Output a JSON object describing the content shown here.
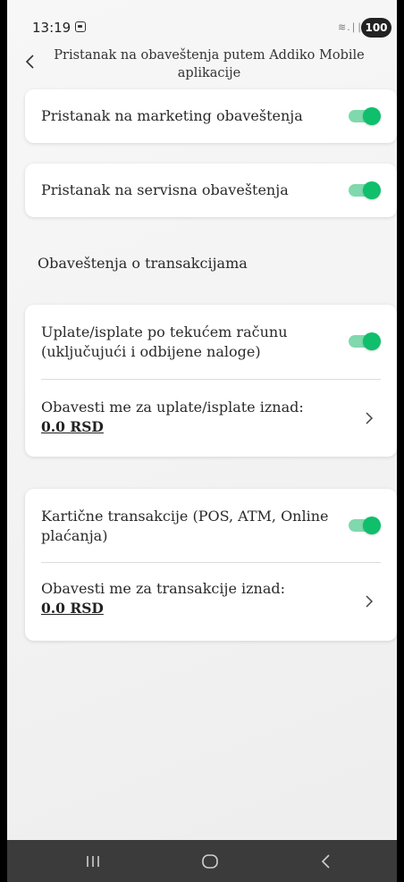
{
  "status_bar": {
    "time": "13:19",
    "signal": "≋.∣∣",
    "battery": "100"
  },
  "header": {
    "title": "Pristanak na obaveštenja putem Addiko Mobile aplikacije"
  },
  "settings": {
    "marketing": {
      "label": "Pristanak na marketing obaveštenja",
      "enabled": true
    },
    "service": {
      "label": "Pristanak na servisna obaveštenja",
      "enabled": true
    }
  },
  "transactions": {
    "section_label": "Obaveštenja o transakcijama",
    "account": {
      "label": "Uplate/isplate po tekućem računu (uključujući i odbijene naloge)",
      "enabled": true,
      "threshold_label": "Obavesti me za uplate/isplate iznad:",
      "threshold_amount": "0.0 RSD"
    },
    "card": {
      "label": "Kartične transakcije (POS, ATM, Online plaćanja)",
      "enabled": true,
      "threshold_label": "Obavesti me za transakcije iznad:",
      "threshold_amount": "0.0 RSD"
    }
  },
  "colors": {
    "accent": "#0fbf6b",
    "toggle_track": "#7fd9ad",
    "nav_bar": "#3b3b3b"
  },
  "icons": {
    "back": "chevron-left-icon",
    "next": "chevron-right-icon",
    "nav_recents": "recents-icon",
    "nav_home": "home-icon",
    "nav_back": "back-icon"
  }
}
